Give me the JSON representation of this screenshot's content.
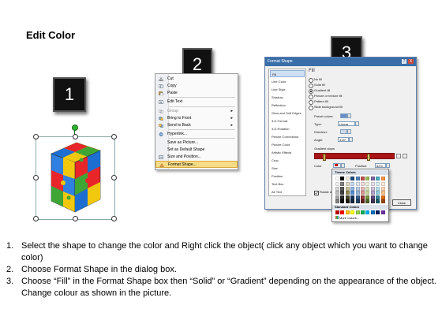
{
  "title": "Edit Color",
  "steps": [
    "1",
    "2",
    "3"
  ],
  "context_menu": {
    "items": [
      {
        "label": "Cut",
        "icon": "scissors-icon",
        "disabled": false,
        "arrow": false,
        "underline": "t"
      },
      {
        "label": "Copy",
        "icon": "copy-icon",
        "disabled": false,
        "arrow": false
      },
      {
        "label": "Paste",
        "icon": "paste-icon",
        "disabled": false,
        "arrow": false
      },
      {
        "label": "Edit Text",
        "icon": "edit-text-icon",
        "disabled": false,
        "arrow": false
      },
      {
        "label": "Group",
        "icon": "group-icon",
        "disabled": true,
        "arrow": true
      },
      {
        "label": "Bring to Front",
        "icon": "bring-front-icon",
        "disabled": false,
        "arrow": true
      },
      {
        "label": "Send to Back",
        "icon": "send-back-icon",
        "disabled": false,
        "arrow": true
      },
      {
        "label": "Hyperlink...",
        "icon": "hyperlink-icon",
        "disabled": false,
        "arrow": false
      },
      {
        "label": "Save as Picture...",
        "icon": "",
        "disabled": false,
        "arrow": false
      },
      {
        "label": "Set as Default Shape",
        "icon": "",
        "disabled": false,
        "arrow": false
      },
      {
        "label": "Size and Position...",
        "icon": "size-position-icon",
        "disabled": false,
        "arrow": false
      },
      {
        "label": "Format Shape...",
        "icon": "format-shape-icon",
        "disabled": false,
        "arrow": false,
        "highlighted": true
      }
    ]
  },
  "dialog": {
    "title": "Format Shape",
    "help": "?",
    "close_x": "X",
    "nav": [
      "Fill",
      "Line Color",
      "Line Style",
      "Shadow",
      "Reflection",
      "Glow and Soft Edges",
      "3-D Format",
      "3-D Rotation",
      "Picture Corrections",
      "Picture Color",
      "Artistic Effects",
      "Crop",
      "Size",
      "Position",
      "Text Box",
      "Alt Text"
    ],
    "pane_title": "Fill",
    "fill_options": [
      {
        "label": "No fill",
        "on": false
      },
      {
        "label": "Solid fill",
        "on": false
      },
      {
        "label": "Gradient fill",
        "on": true
      },
      {
        "label": "Picture or texture fill",
        "on": false
      },
      {
        "label": "Pattern fill",
        "on": false
      },
      {
        "label": "Slide background fill",
        "on": false
      }
    ],
    "preset_label": "Preset colors:",
    "type_label": "Type:",
    "type_value": "Linear",
    "direction_label": "Direction:",
    "angle_label": "Angle:",
    "angle_value": "315°",
    "gradient_stops_label": "Gradient stops",
    "color_label": "Color",
    "position_label": "Position:",
    "position_value": "82%",
    "brightness_label": "Brightness:",
    "transparency_label": "Transparency:",
    "rotate_label": "Rotate with shape",
    "close_label": "Close"
  },
  "color_popup": {
    "theme_label": "Theme Colors",
    "standard_label": "Standard Colors",
    "more_label": "More Colors...",
    "theme_top": [
      "#ffffff",
      "#000000",
      "#eeece1",
      "#1f497d",
      "#4f81bd",
      "#c0504d",
      "#9bbb59",
      "#8064a2",
      "#4bacc6",
      "#f79646"
    ],
    "theme_shades": [
      [
        "#f2f2f2",
        "#7f7f7f",
        "#ddd9c3",
        "#c6d9f0",
        "#dbe5f1",
        "#f2dcdb",
        "#ebf1dd",
        "#e5e0ec",
        "#dbeef3",
        "#fdeada"
      ],
      [
        "#d8d8d8",
        "#595959",
        "#c4bd97",
        "#8db3e2",
        "#b8cce4",
        "#e5b9b7",
        "#d7e3bc",
        "#ccc1d9",
        "#b7dde8",
        "#fbd5b5"
      ],
      [
        "#bfbfbf",
        "#3f3f3f",
        "#938953",
        "#548dd4",
        "#95b3d7",
        "#d99694",
        "#c3d69b",
        "#b2a2c7",
        "#92cddc",
        "#fac08f"
      ],
      [
        "#a5a5a5",
        "#262626",
        "#494429",
        "#17365d",
        "#366092",
        "#953734",
        "#76923c",
        "#5f497a",
        "#31859b",
        "#e36c09"
      ],
      [
        "#7f7f7f",
        "#0c0c0c",
        "#1d1b10",
        "#0f243e",
        "#244061",
        "#632423",
        "#4f6128",
        "#3f3151",
        "#205867",
        "#974806"
      ]
    ],
    "standard": [
      "#c00000",
      "#ff0000",
      "#ffc000",
      "#ffff00",
      "#92d050",
      "#00b050",
      "#00b0f0",
      "#0070c0",
      "#002060",
      "#7030a0"
    ]
  },
  "instructions": [
    {
      "num": "1.",
      "text": "Select the shape to change the color and Right click the object( click any object which you want to change color)"
    },
    {
      "num": "2.",
      "text": "Choose Format Shape in the dialog box."
    },
    {
      "num": "3.",
      "text": "Choose “Fill” in the Format Shape box then “Solid” or “Gradient” depending on the appearance of the object. Change colour as shown in the picture."
    }
  ]
}
